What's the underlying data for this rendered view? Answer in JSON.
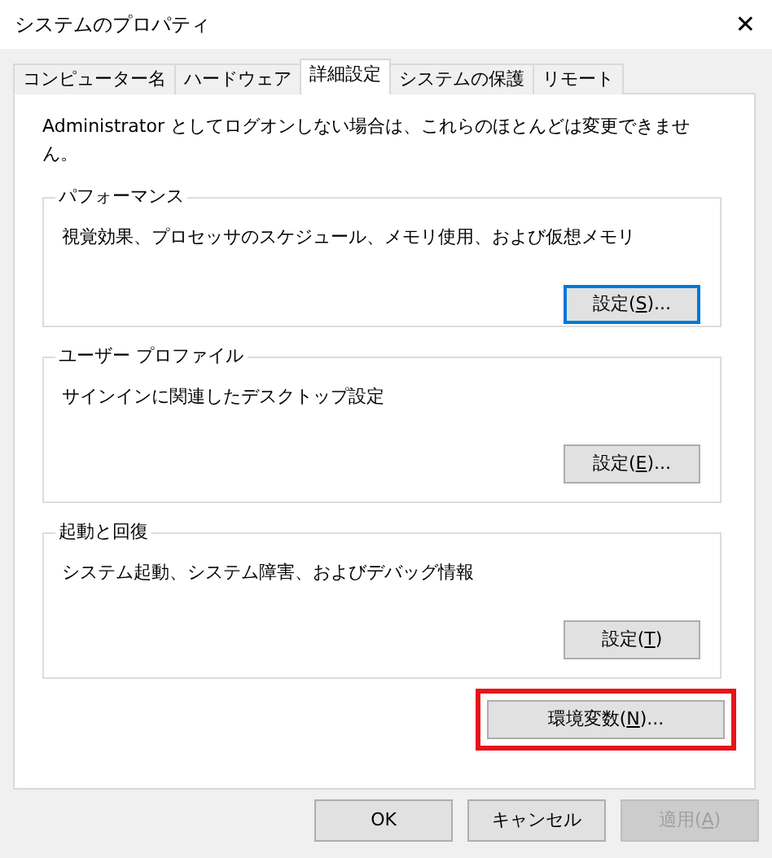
{
  "window": {
    "title": "システムのプロパティ",
    "close": "✕"
  },
  "tabs": [
    {
      "label": "コンピューター名",
      "selected": false
    },
    {
      "label": "ハードウェア",
      "selected": false
    },
    {
      "label": "詳細設定",
      "selected": true
    },
    {
      "label": "システムの保護",
      "selected": false
    },
    {
      "label": "リモート",
      "selected": false
    }
  ],
  "notice": "Administrator としてログオンしない場合は、これらのほとんどは変更できません。",
  "groups": [
    {
      "title": "パフォーマンス",
      "description": "視覚効果、プロセッサのスケジュール、メモリ使用、および仮想メモリ",
      "button": {
        "prefix": "設定(",
        "access_key": "S",
        "suffix": ")...",
        "focused": true
      }
    },
    {
      "title": "ユーザー プロファイル",
      "description": "サインインに関連したデスクトップ設定",
      "button": {
        "prefix": "設定(",
        "access_key": "E",
        "suffix": ")...",
        "focused": false
      }
    },
    {
      "title": "起動と回復",
      "description": "システム起動、システム障害、およびデバッグ情報",
      "button": {
        "prefix": "設定(",
        "access_key": "T",
        "suffix": ")",
        "focused": false
      }
    }
  ],
  "env_button": {
    "prefix": "環境変数(",
    "access_key": "N",
    "suffix": ")...",
    "highlighted": true
  },
  "footer_buttons": [
    {
      "prefix": "OK",
      "disabled": false
    },
    {
      "prefix": "キャンセル",
      "disabled": false
    },
    {
      "prefix": "適用(",
      "access_key": "A",
      "suffix": ")",
      "disabled": true
    }
  ]
}
